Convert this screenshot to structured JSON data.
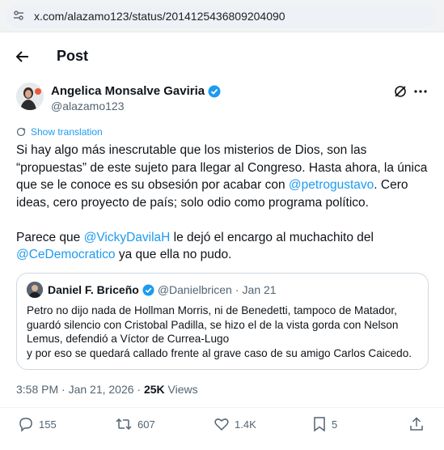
{
  "browser": {
    "url": "x.com/alazamo123/status/2014125436809204090"
  },
  "header": {
    "title": "Post"
  },
  "post": {
    "author_name": "Angelica Monsalve Gaviria",
    "author_handle": "@alazamo123",
    "show_translation": "Show translation",
    "paragraph1": {
      "part1": "Si hay algo más inescrutable que los misterios de Dios, son las “propuestas” de este sujeto para llegar al Congreso. Hasta ahora, la única que se le conoce es su obsesión por acabar con ",
      "mention": "@petrogustavo",
      "part2": ". Cero ideas, cero proyecto de país; solo odio como programa político."
    },
    "paragraph2": {
      "part1": "Parece que ",
      "mention1": "@VickyDavilaH",
      "part2": " le dejó el encargo al muchachito del ",
      "mention2": "@CeDemocratico",
      "part3": " ya que ella no pudo."
    },
    "timestamp": "3:58 PM · Jan 21, 2026 · ",
    "views_count": "25K",
    "views_label": " Views"
  },
  "quote": {
    "name": "Daniel F. Briceño",
    "handle": "@Danielbricen",
    "dot": "·",
    "date": "Jan 21",
    "line1": "Petro no dijo nada de Hollman Morris, ni de Benedetti, tampoco de Matador,",
    "line2": "guardó silencio con Cristobal Padilla, se hizo el de la vista gorda con Nelson",
    "line3": "Lemus, defendió a Víctor de Currea-Lugo",
    "line4": "y por eso se quedará callado frente al grave caso de su amigo Carlos Caicedo."
  },
  "actions": {
    "replies": "155",
    "reposts": "607",
    "likes": "1.4K",
    "bookmarks": "5"
  },
  "colors": {
    "accent": "#1d9bf0",
    "text": "#0f1419",
    "secondary": "#536471",
    "border": "#cfd9de"
  }
}
